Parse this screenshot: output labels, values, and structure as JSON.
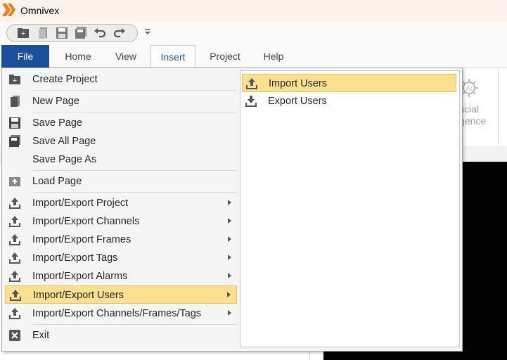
{
  "app": {
    "title": "Omnivex",
    "accent_color": "#f07c1a"
  },
  "ribbon": {
    "tabs": [
      {
        "label": "File"
      },
      {
        "label": "Home"
      },
      {
        "label": "View"
      },
      {
        "label": "Insert"
      },
      {
        "label": "Project"
      },
      {
        "label": "Help"
      }
    ],
    "active_tab": "Insert",
    "ai_group": {
      "line1": "ificial",
      "line2": "igence"
    }
  },
  "colors": {
    "file_tab_bg": "#1b4f9c",
    "highlight": "#fbe08f",
    "canvas": "#030303"
  },
  "file_menu": {
    "items": [
      {
        "label": "Create Project",
        "icon": "create-project-icon",
        "submenu": false
      },
      {
        "label": "New Page",
        "icon": "new-page-icon",
        "submenu": false
      },
      {
        "label": "Save Page",
        "icon": "save-icon",
        "submenu": false
      },
      {
        "label": "Save All Page",
        "icon": "save-all-icon",
        "submenu": false
      },
      {
        "label": "Save Page As",
        "icon": "",
        "submenu": false
      },
      {
        "label": "Load Page",
        "icon": "load-page-icon",
        "submenu": false
      },
      {
        "label": "Import/Export Project",
        "icon": "upload-icon",
        "submenu": true
      },
      {
        "label": "Import/Export Channels",
        "icon": "upload-icon",
        "submenu": true
      },
      {
        "label": "Import/Export Frames",
        "icon": "upload-icon",
        "submenu": true
      },
      {
        "label": "Import/Export Tags",
        "icon": "upload-icon",
        "submenu": true
      },
      {
        "label": "Import/Export Alarms",
        "icon": "upload-icon",
        "submenu": true
      },
      {
        "label": "Import/Export Users",
        "icon": "upload-icon",
        "submenu": true,
        "highlighted": true
      },
      {
        "label": "Import/Export Channels/Frames/Tags",
        "icon": "upload-icon",
        "submenu": true
      },
      {
        "label": "Exit",
        "icon": "exit-icon",
        "submenu": false
      }
    ]
  },
  "submenu": {
    "items": [
      {
        "label": "Import Users",
        "icon": "upload-icon",
        "highlighted": true
      },
      {
        "label": "Export Users",
        "icon": "download-icon"
      }
    ]
  }
}
